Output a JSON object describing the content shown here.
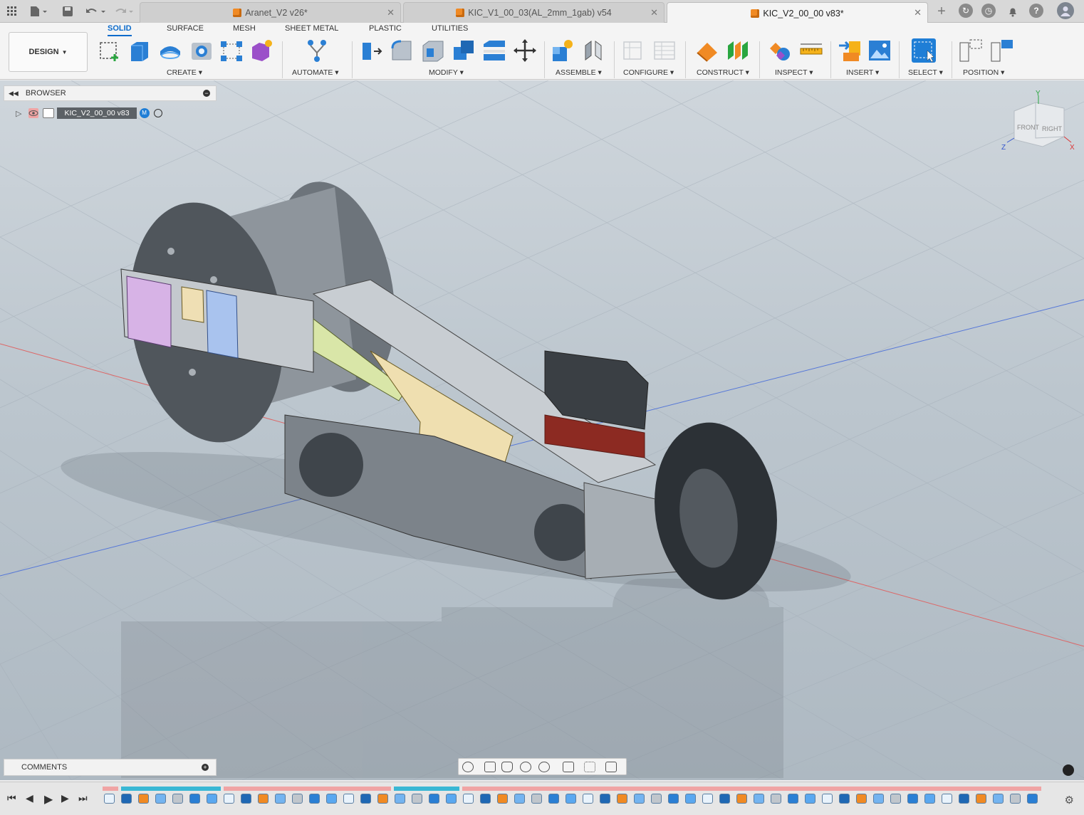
{
  "tabs": [
    {
      "label": "Aranet_V2 v26*",
      "active": false
    },
    {
      "label": "KIC_V1_00_03(AL_2mm_1gab) v54",
      "active": false
    },
    {
      "label": "KIC_V2_00_00 v83*",
      "active": true
    }
  ],
  "workspace": {
    "label": "DESIGN"
  },
  "ribbon_tabs": [
    "SOLID",
    "SURFACE",
    "MESH",
    "SHEET METAL",
    "PLASTIC",
    "UTILITIES"
  ],
  "ribbon_groups": [
    "CREATE",
    "AUTOMATE",
    "MODIFY",
    "ASSEMBLE",
    "CONFIGURE",
    "CONSTRUCT",
    "INSPECT",
    "INSERT",
    "SELECT",
    "POSITION"
  ],
  "browser": {
    "title": "BROWSER",
    "root_item": "KIC_V2_00_00 v83"
  },
  "comments": {
    "title": "COMMENTS"
  },
  "viewcube": {
    "front": "FRONT",
    "right": "RIGHT",
    "x": "X",
    "y": "Y",
    "z": "Z"
  },
  "colors": {
    "accent": "#0b6bcb",
    "doc_cube": "#f08a24",
    "timeline_red": "#f0a4a4",
    "timeline_teal": "#39b7d4"
  }
}
